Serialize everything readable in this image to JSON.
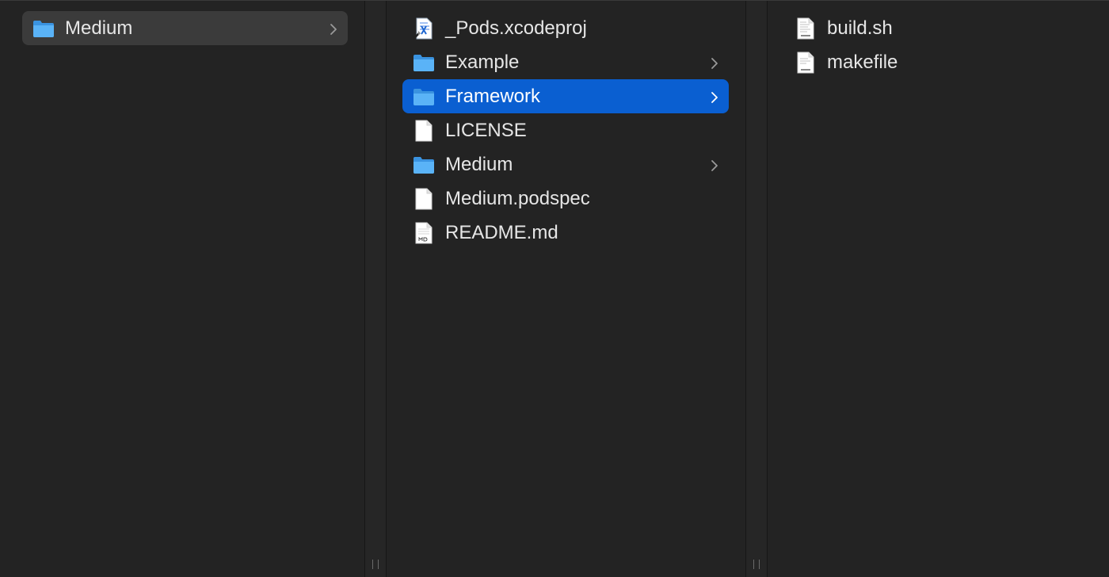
{
  "columns": [
    {
      "items": [
        {
          "name": "Medium",
          "kind": "folder",
          "icon": "folder-icon",
          "has_children": true,
          "state": "selected-inactive"
        }
      ]
    },
    {
      "items": [
        {
          "name": "_Pods.xcodeproj",
          "kind": "xcodeproj",
          "icon": "xcodeproj-icon",
          "has_children": false
        },
        {
          "name": "Example",
          "kind": "folder",
          "icon": "folder-icon",
          "has_children": true
        },
        {
          "name": "Framework",
          "kind": "folder",
          "icon": "folder-icon",
          "has_children": true,
          "state": "selected"
        },
        {
          "name": "LICENSE",
          "kind": "file",
          "icon": "document-icon",
          "has_children": false
        },
        {
          "name": "Medium",
          "kind": "folder",
          "icon": "folder-icon",
          "has_children": true
        },
        {
          "name": "Medium.podspec",
          "kind": "file",
          "icon": "document-icon",
          "has_children": false
        },
        {
          "name": "README.md",
          "kind": "file",
          "icon": "markdown-file-icon",
          "has_children": false
        }
      ]
    },
    {
      "items": [
        {
          "name": "build.sh",
          "kind": "shell",
          "icon": "shell-script-icon",
          "has_children": false
        },
        {
          "name": "makefile",
          "kind": "make",
          "icon": "makefile-icon",
          "has_children": false
        }
      ]
    }
  ],
  "colors": {
    "background": "#232323",
    "selection": "#0a5fd1",
    "inactive_selection": "#3b3b3b",
    "folder_blue": "#4aa8f5",
    "text": "#e6e6e6"
  }
}
